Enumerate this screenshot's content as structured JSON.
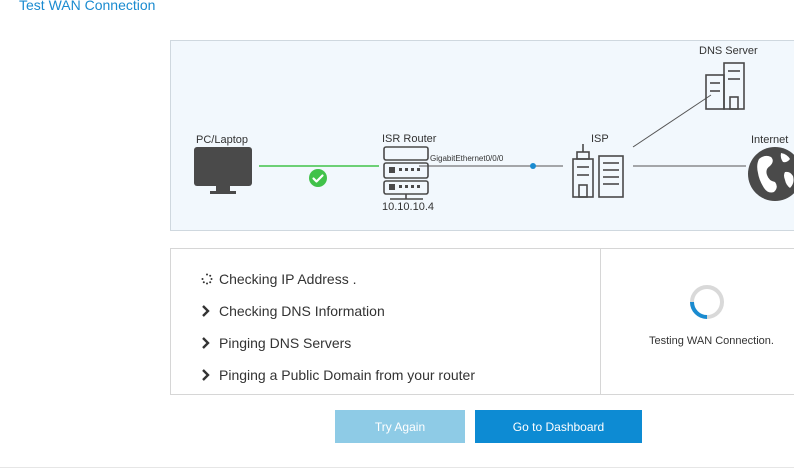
{
  "page": {
    "title": "Test WAN Connection"
  },
  "topology": {
    "pc_label": "PC/Laptop",
    "router_label": "ISR Router",
    "router_ip": "10.10.10.4",
    "link_label": "GigabitEthernet0/0/0",
    "isp_label": "ISP",
    "dns_label": "DNS Server",
    "internet_label": "Internet",
    "link_ok_color": "#41c24a",
    "accent_color": "#1a8bd0"
  },
  "checks": [
    {
      "label": "Checking IP Address .",
      "state": "in-progress",
      "icon": "loading-spinner-icon"
    },
    {
      "label": "Checking DNS Information",
      "state": "pending",
      "icon": "chevron-right-icon"
    },
    {
      "label": "Pinging DNS Servers",
      "state": "pending",
      "icon": "chevron-right-icon"
    },
    {
      "label": "Pinging a Public Domain from your router",
      "state": "pending",
      "icon": "chevron-right-icon"
    }
  ],
  "progress": {
    "label": "Testing WAN Connection."
  },
  "buttons": {
    "try_again": "Try Again",
    "dashboard": "Go to Dashboard"
  }
}
